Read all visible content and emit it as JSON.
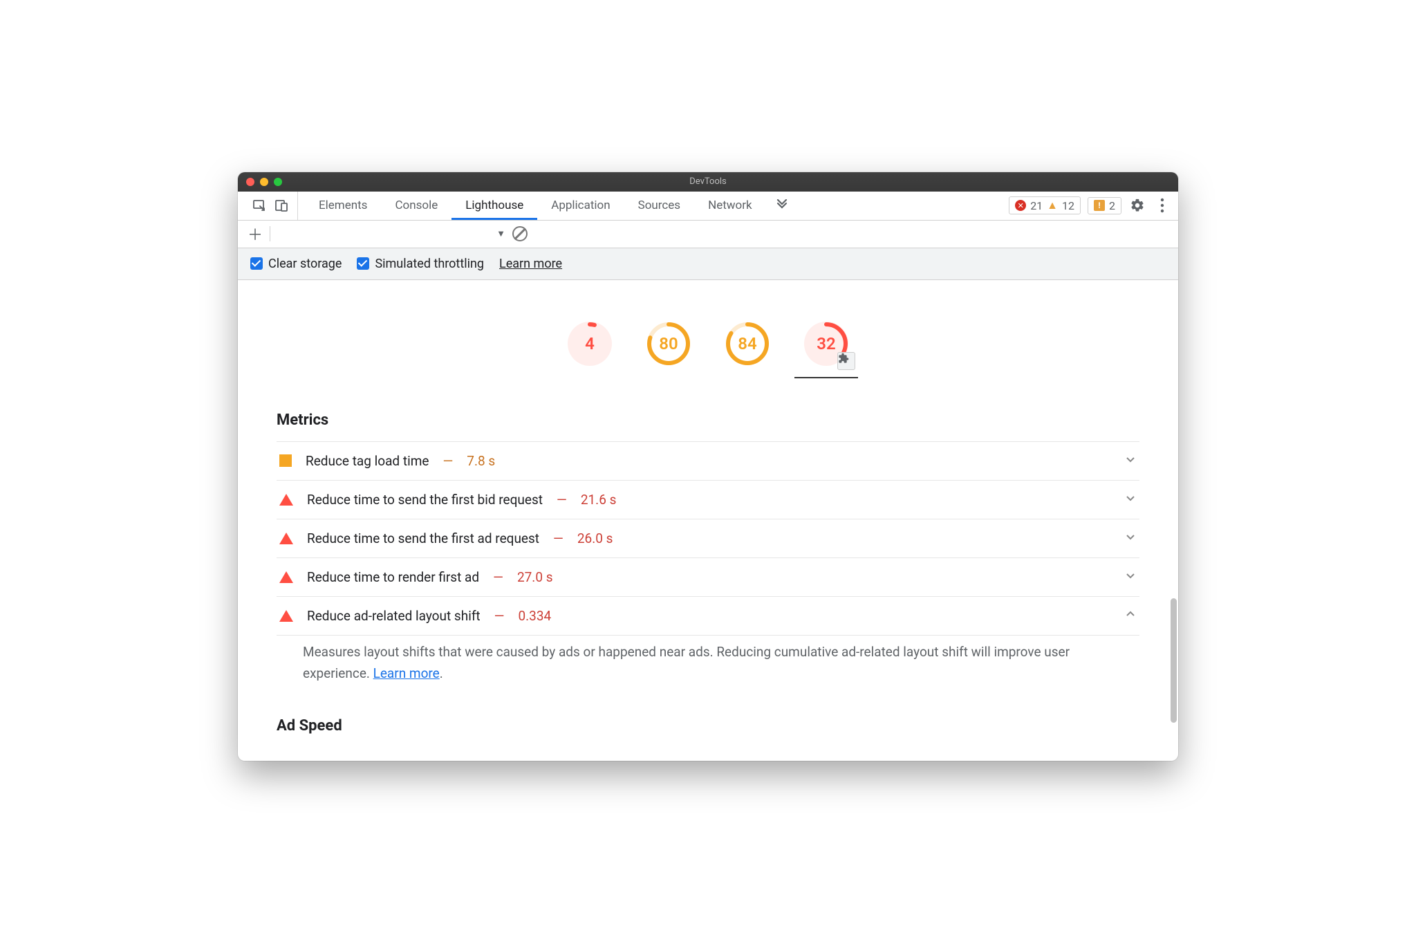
{
  "window": {
    "title": "DevTools"
  },
  "tabs": [
    "Elements",
    "Console",
    "Lighthouse",
    "Application",
    "Sources",
    "Network"
  ],
  "activeTab": "Lighthouse",
  "badges": {
    "errors": "21",
    "warnings": "12",
    "issues": "2"
  },
  "options": {
    "clear_storage": "Clear storage",
    "simulated_throttling": "Simulated throttling",
    "learn_more": "Learn more"
  },
  "scores": [
    {
      "value": "4",
      "color": "red",
      "pct": 4
    },
    {
      "value": "80",
      "color": "orange",
      "pct": 80
    },
    {
      "value": "84",
      "color": "orange",
      "pct": 84
    },
    {
      "value": "32",
      "color": "red",
      "pct": 32,
      "hasExtension": true,
      "selected": true
    }
  ],
  "sections": {
    "metrics_title": "Metrics",
    "ad_speed_title": "Ad Speed"
  },
  "metrics": [
    {
      "icon": "square",
      "label": "Reduce tag load time",
      "value": "7.8 s",
      "color": "orange",
      "expanded": false
    },
    {
      "icon": "triangle",
      "label": "Reduce time to send the first bid request",
      "value": "21.6 s",
      "color": "red",
      "expanded": false
    },
    {
      "icon": "triangle",
      "label": "Reduce time to send the first ad request",
      "value": "26.0 s",
      "color": "red",
      "expanded": false
    },
    {
      "icon": "triangle",
      "label": "Reduce time to render first ad",
      "value": "27.0 s",
      "color": "red",
      "expanded": false
    },
    {
      "icon": "triangle",
      "label": "Reduce ad-related layout shift",
      "value": "0.334",
      "color": "red",
      "expanded": true,
      "desc_pre": "Measures layout shifts that were caused by ads or happened near ads. Reducing cumulative ad-related layout shift will improve user experience. ",
      "desc_link": "Learn more",
      "desc_post": "."
    }
  ]
}
